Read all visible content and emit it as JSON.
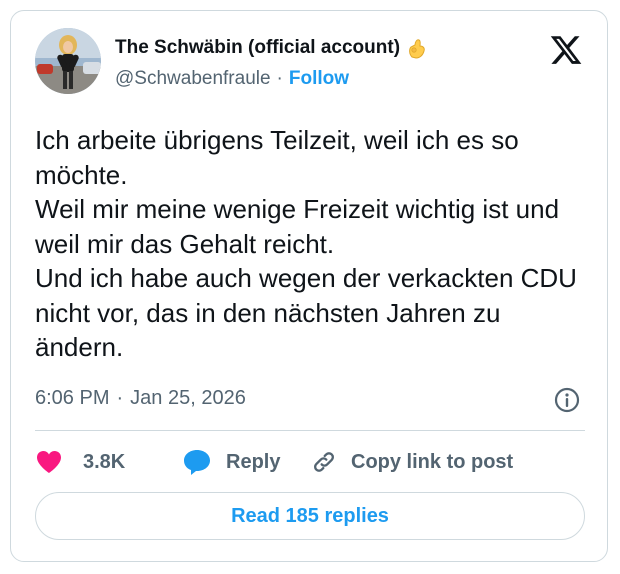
{
  "author": {
    "display_name": "The Schwäbin (official account)",
    "handle": "@Schwabenfraule",
    "follow_label": "Follow",
    "separator": "·",
    "badge_icon": "ok-hand-emoji-icon"
  },
  "tweet": {
    "lines": [
      "Ich arbeite übrigens Teilzeit, weil ich es so möchte.",
      "Weil mir meine wenige Freizeit wichtig ist und weil mir das Gehalt reicht.",
      "Und ich habe auch wegen der verkackten CDU nicht vor, das in den nächsten Jahren zu ändern."
    ],
    "time": "6:06 PM",
    "separator": "·",
    "date": "Jan 25, 2026"
  },
  "actions": {
    "like_count": "3.8K",
    "reply_label": "Reply",
    "copy_label": "Copy link to post"
  },
  "read_replies_label": "Read 185 replies",
  "colors": {
    "accent": "#1d9bf0",
    "like": "#f91880",
    "text": "#0f1419",
    "muted": "#536471",
    "border": "#cfd9de"
  }
}
